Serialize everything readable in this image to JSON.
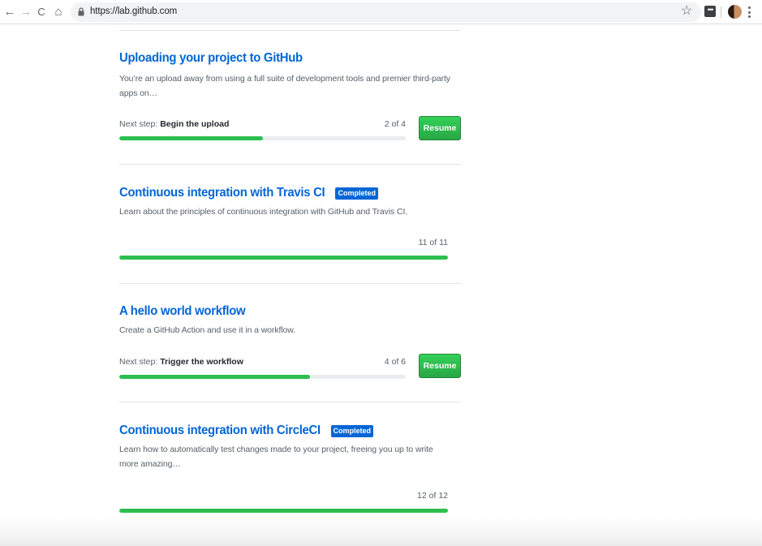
{
  "browser": {
    "url": "https://lab.github.com",
    "back_icon": "←",
    "forward_icon": "→",
    "reload_icon": "C",
    "home_icon": "⌂",
    "star_icon": "☆"
  },
  "courses": [
    {
      "title": "Uploading your project to GitHub",
      "description": "You’re an upload away from using a full suite of development tools and premier third-party apps on…",
      "next_step_prefix": "Next step: ",
      "next_step": "Begin the upload",
      "progress_text": "2 of 4",
      "progress": 0.5,
      "action": "Resume"
    },
    {
      "title": "Continuous integration with Travis CI",
      "badge": "Completed",
      "description": "Learn about the principles of continuous integration with GitHub and Travis CI.",
      "progress_text": "11 of 11",
      "progress": 1.0
    },
    {
      "title": "A hello world workflow",
      "description": "Create a GitHub Action and use it in a workflow.",
      "next_step_prefix": "Next step: ",
      "next_step": "Trigger the workflow",
      "progress_text": "4 of 6",
      "progress": 0.667,
      "action": "Resume"
    },
    {
      "title": "Continuous integration with CircleCI",
      "badge": "Completed",
      "description": "Learn how to automatically test changes made to your project, freeing you up to write more amazing…",
      "progress_text": "12 of 12",
      "progress": 1.0
    }
  ],
  "colors": {
    "link": "#0366d6",
    "progress_fill": "#2cbe4e",
    "progress_track": "#eaecef",
    "button": "#28a745",
    "badge": "#0366d6"
  }
}
